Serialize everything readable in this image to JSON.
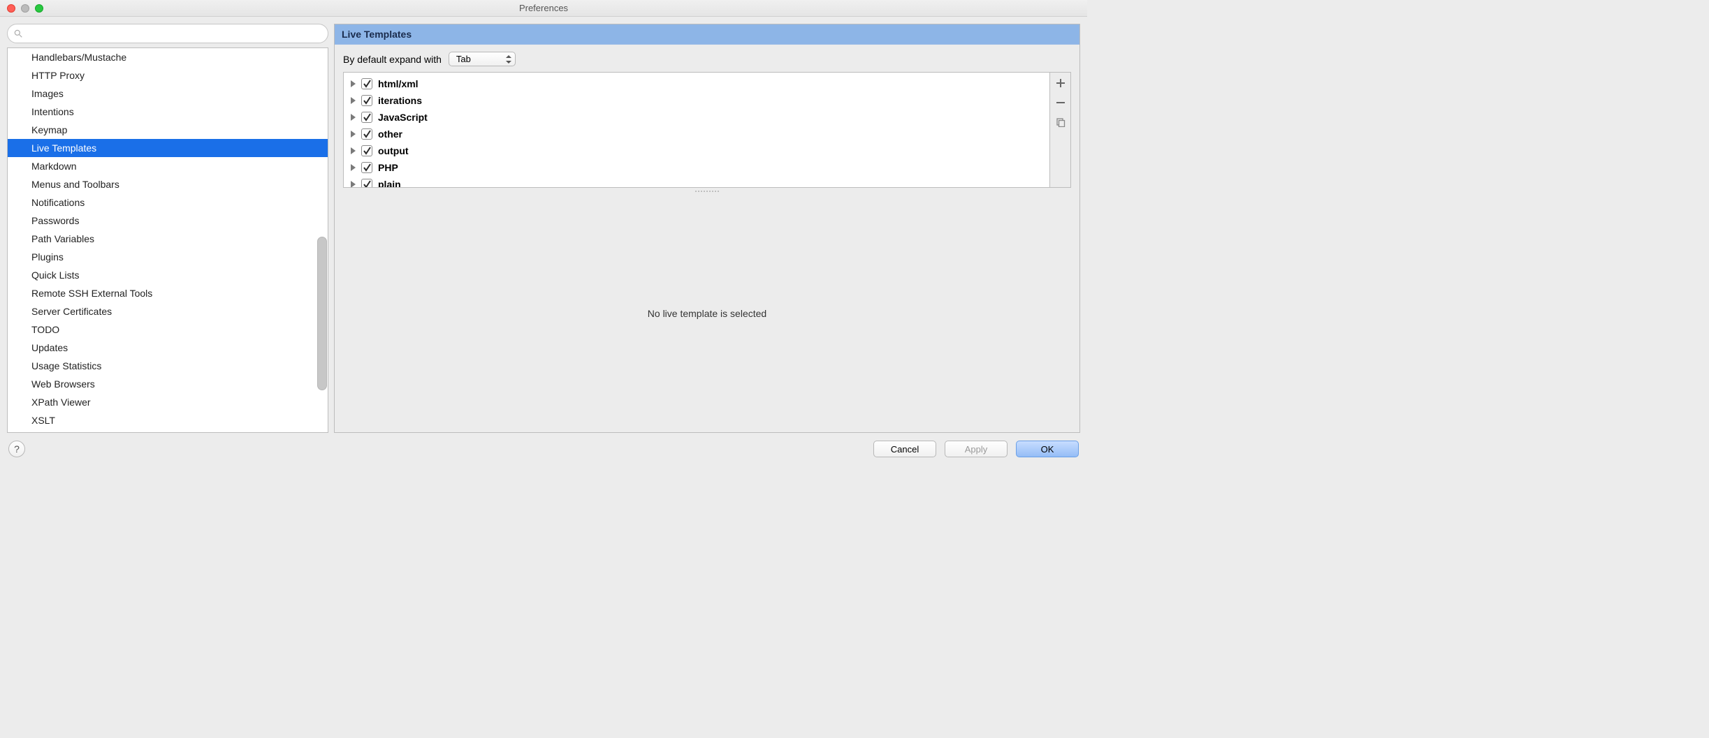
{
  "window": {
    "title": "Preferences"
  },
  "search": {
    "placeholder": ""
  },
  "sidebar": {
    "items": [
      {
        "label": "Handlebars/Mustache",
        "selected": false
      },
      {
        "label": "HTTP Proxy",
        "selected": false
      },
      {
        "label": "Images",
        "selected": false
      },
      {
        "label": "Intentions",
        "selected": false
      },
      {
        "label": "Keymap",
        "selected": false
      },
      {
        "label": "Live Templates",
        "selected": true
      },
      {
        "label": "Markdown",
        "selected": false
      },
      {
        "label": "Menus and Toolbars",
        "selected": false
      },
      {
        "label": "Notifications",
        "selected": false
      },
      {
        "label": "Passwords",
        "selected": false
      },
      {
        "label": "Path Variables",
        "selected": false
      },
      {
        "label": "Plugins",
        "selected": false
      },
      {
        "label": "Quick Lists",
        "selected": false
      },
      {
        "label": "Remote SSH External Tools",
        "selected": false
      },
      {
        "label": "Server Certificates",
        "selected": false
      },
      {
        "label": "TODO",
        "selected": false
      },
      {
        "label": "Updates",
        "selected": false
      },
      {
        "label": "Usage Statistics",
        "selected": false
      },
      {
        "label": "Web Browsers",
        "selected": false
      },
      {
        "label": "XPath Viewer",
        "selected": false
      },
      {
        "label": "XSLT",
        "selected": false
      }
    ]
  },
  "main": {
    "header": "Live Templates",
    "expand_label": "By default expand with",
    "expand_value": "Tab",
    "templates": [
      {
        "label": "html/xml",
        "checked": true
      },
      {
        "label": "iterations",
        "checked": true
      },
      {
        "label": "JavaScript",
        "checked": true
      },
      {
        "label": "other",
        "checked": true
      },
      {
        "label": "output",
        "checked": true
      },
      {
        "label": "PHP",
        "checked": true
      },
      {
        "label": "plain",
        "checked": true
      }
    ],
    "empty_text": "No live template is selected"
  },
  "footer": {
    "help": "?",
    "cancel": "Cancel",
    "apply": "Apply",
    "ok": "OK"
  }
}
